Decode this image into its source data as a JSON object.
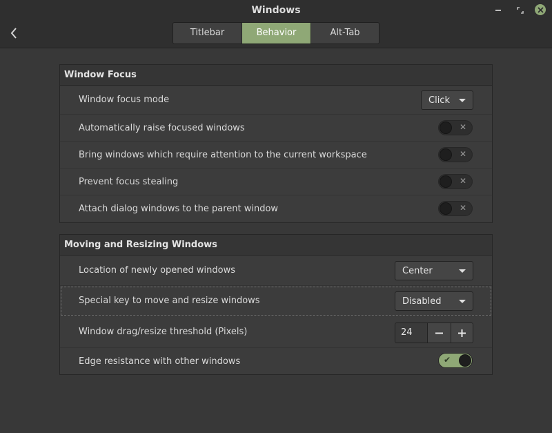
{
  "window": {
    "title": "Windows"
  },
  "colors": {
    "accent": "#8fa876",
    "background": "#383838",
    "headerbar": "#2f2f2f"
  },
  "icons": {
    "back": "chevron-left-icon",
    "minimize": "minimize-icon",
    "maximize": "maximize-icon",
    "close": "close-icon"
  },
  "tabs": [
    {
      "label": "Titlebar",
      "active": false
    },
    {
      "label": "Behavior",
      "active": true
    },
    {
      "label": "Alt-Tab",
      "active": false
    }
  ],
  "focus": {
    "title": "Window Focus",
    "mode_label": "Window focus mode",
    "mode_value": "Click",
    "raise_label": "Automatically raise focused windows",
    "raise_on": false,
    "attention_label": "Bring windows which require attention to the current workspace",
    "attention_on": false,
    "steal_label": "Prevent focus stealing",
    "steal_on": false,
    "attach_label": "Attach dialog windows to the parent window",
    "attach_on": false
  },
  "moving": {
    "title": "Moving and Resizing Windows",
    "location_label": "Location of newly opened windows",
    "location_value": "Center",
    "key_label": "Special key to move and resize windows",
    "key_value": "Disabled",
    "threshold_label": "Window drag/resize threshold (Pixels)",
    "threshold_value": "24",
    "edge_label": "Edge resistance with other windows",
    "edge_on": true
  }
}
